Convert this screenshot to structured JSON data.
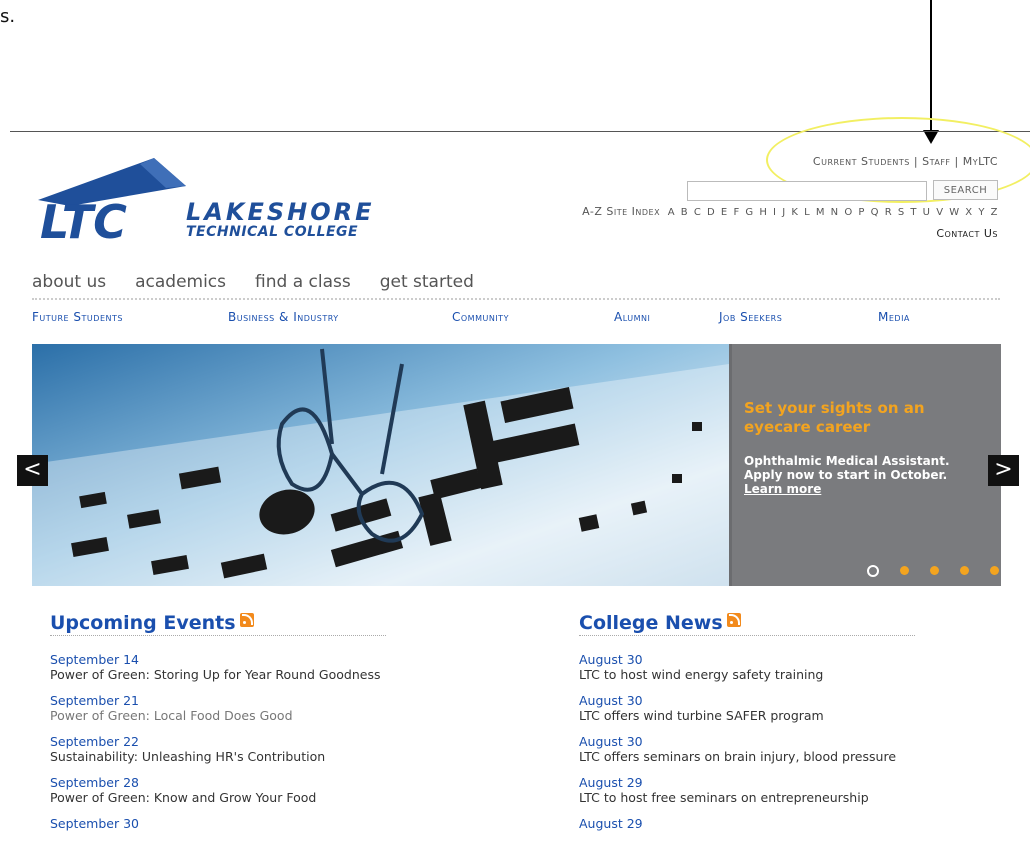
{
  "annotation": {
    "snippet": "s."
  },
  "utility_nav": {
    "current_students": "Current Students",
    "staff": "Staff",
    "myltc": "MyLTC",
    "separator": "|"
  },
  "search": {
    "placeholder": "",
    "button": "SEARCH"
  },
  "az_index": {
    "label": "A-Z Site Index",
    "letters": [
      "A",
      "B",
      "C",
      "D",
      "E",
      "F",
      "G",
      "H",
      "I",
      "J",
      "K",
      "L",
      "M",
      "N",
      "O",
      "P",
      "Q",
      "R",
      "S",
      "T",
      "U",
      "V",
      "W",
      "X",
      "Y",
      "Z"
    ]
  },
  "contact": "Contact Us",
  "logo": {
    "mark": "LTC",
    "line1": "LAKESHORE",
    "line2": "TECHNICAL COLLEGE"
  },
  "primary_nav": [
    "about us",
    "academics",
    "find a class",
    "get started"
  ],
  "secondary_nav": [
    "Future Students",
    "Business & Industry",
    "Community",
    "Alumni",
    "Job Seekers",
    "Media"
  ],
  "banner": {
    "headline": "Set your sights on an eyecare career",
    "body_line1": "Ophthalmic Medical Assistant.",
    "body_line2": "Apply now to start in October.",
    "link": "Learn more",
    "prev": "<",
    "next": ">",
    "slide_count": 5,
    "active_slide": 1
  },
  "colors": {
    "brand_blue": "#1f4f9a",
    "link_blue": "#1a4fae",
    "orange": "#f3a41f",
    "panel_gray": "#7a7b7e"
  },
  "events": {
    "heading": "Upcoming Events",
    "items": [
      {
        "date": "September 14",
        "title": "Power of Green: Storing Up for Year Round Goodness"
      },
      {
        "date": "September 21",
        "title": "Power of Green: Local Food Does Good"
      },
      {
        "date": "September 22",
        "title": "Sustainability: Unleashing HR's Contribution"
      },
      {
        "date": "September 28",
        "title": "Power of Green: Know and Grow Your Food"
      },
      {
        "date": "September 30",
        "title": ""
      }
    ]
  },
  "news": {
    "heading": "College News",
    "items": [
      {
        "date": "August 30",
        "title": "LTC to host wind energy safety training"
      },
      {
        "date": "August 30",
        "title": "LTC offers wind turbine SAFER program"
      },
      {
        "date": "August 30",
        "title": "LTC offers seminars on brain injury, blood pressure"
      },
      {
        "date": "August 29",
        "title": "LTC to host free seminars on entrepreneurship"
      },
      {
        "date": "August 29",
        "title": ""
      }
    ]
  }
}
